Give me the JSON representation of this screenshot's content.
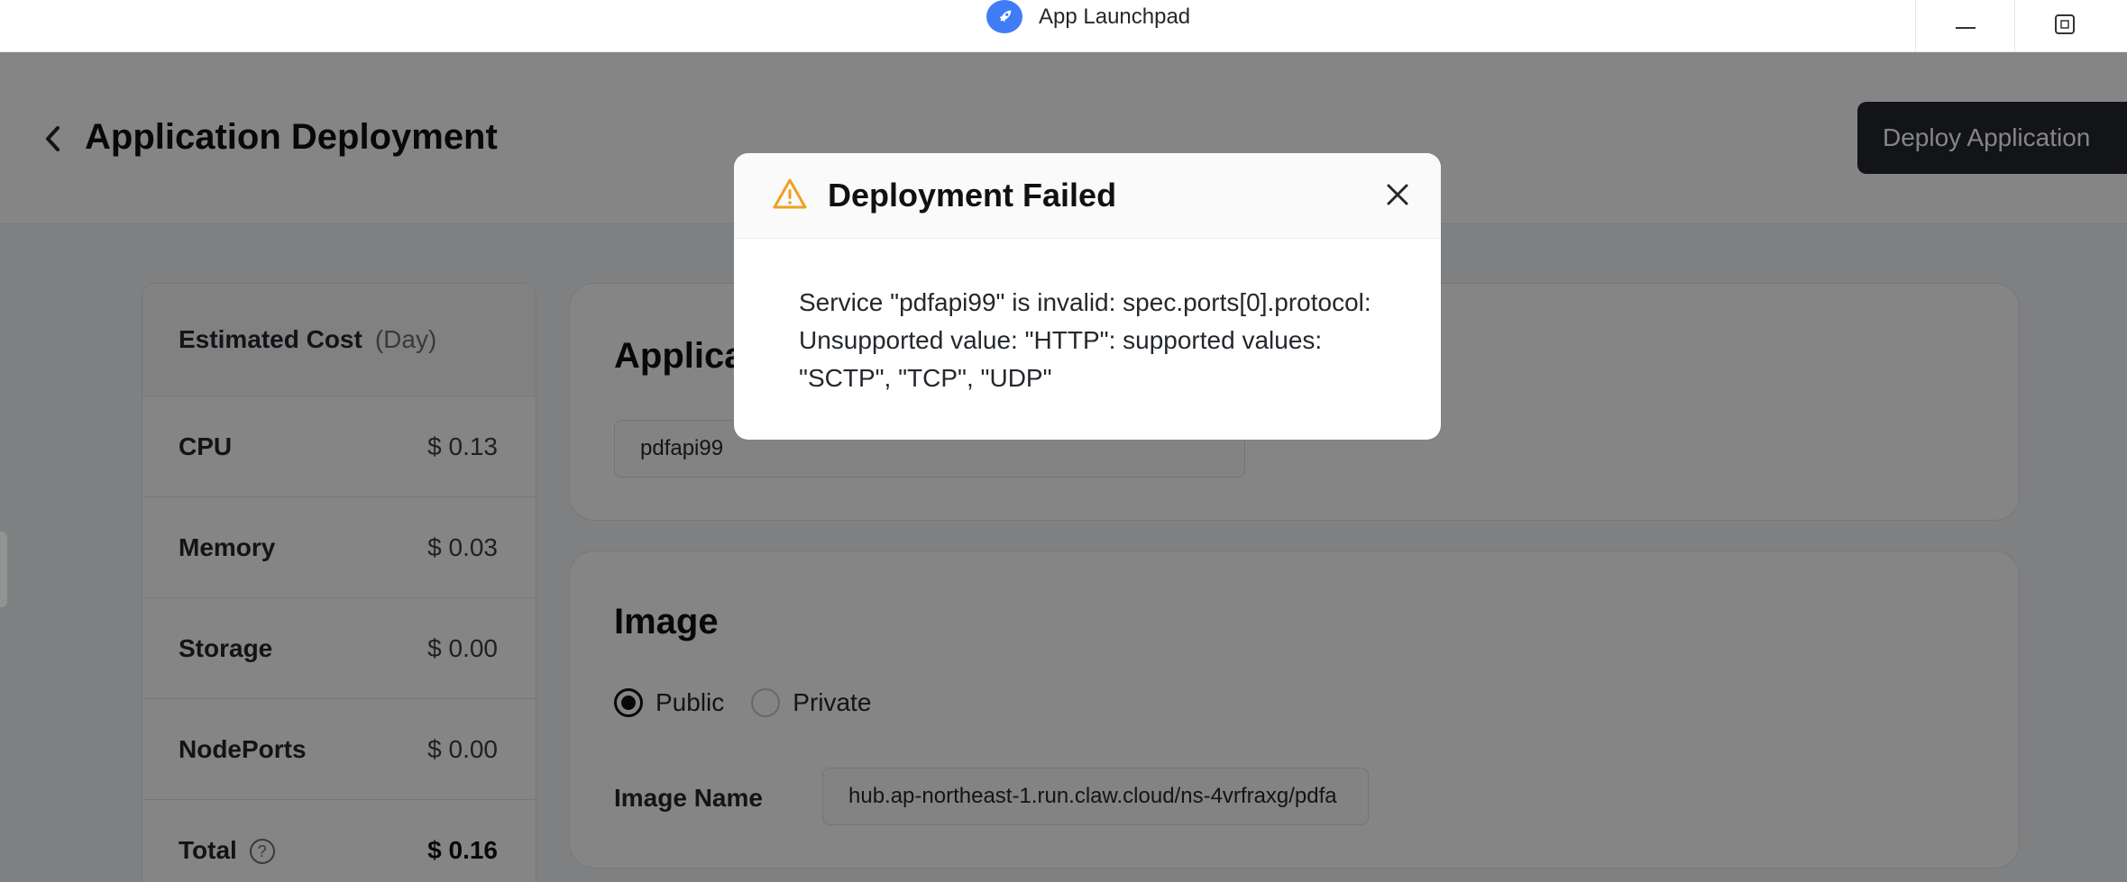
{
  "titlebar": {
    "app_title": "App Launchpad",
    "app_icon": "rocket-icon",
    "minimize_icon": "minimize-icon",
    "maximize_icon": "maximize-icon"
  },
  "header": {
    "back_icon": "chevron-left-icon",
    "title": "Application Deployment",
    "deploy_label": "Deploy Application"
  },
  "cost": {
    "title": "Estimated Cost",
    "unit": "(Day)",
    "rows": [
      {
        "label": "CPU",
        "value": "$ 0.13"
      },
      {
        "label": "Memory",
        "value": "$ 0.03"
      },
      {
        "label": "Storage",
        "value": "$ 0.00"
      },
      {
        "label": "NodePorts",
        "value": "$ 0.00"
      }
    ],
    "total_label": "Total",
    "total_help": "?",
    "total_value": "$ 0.16"
  },
  "app_card": {
    "title": "Applica",
    "name_value": "pdfapi99"
  },
  "image_card": {
    "title": "Image",
    "public_label": "Public",
    "private_label": "Private",
    "selected": "Public",
    "image_name_label": "Image Name",
    "image_name_value": "hub.ap-northeast-1.run.claw.cloud/ns-4vrfraxg/pdfa"
  },
  "modal": {
    "title": "Deployment Failed",
    "message": "Service \"pdfapi99\" is invalid: spec.ports[0].protocol: Unsupported value: \"HTTP\": supported values: \"SCTP\", \"TCP\", \"UDP\"",
    "warning_icon": "warning-icon",
    "close_icon": "close-icon",
    "warning_color": "#f0a020"
  }
}
